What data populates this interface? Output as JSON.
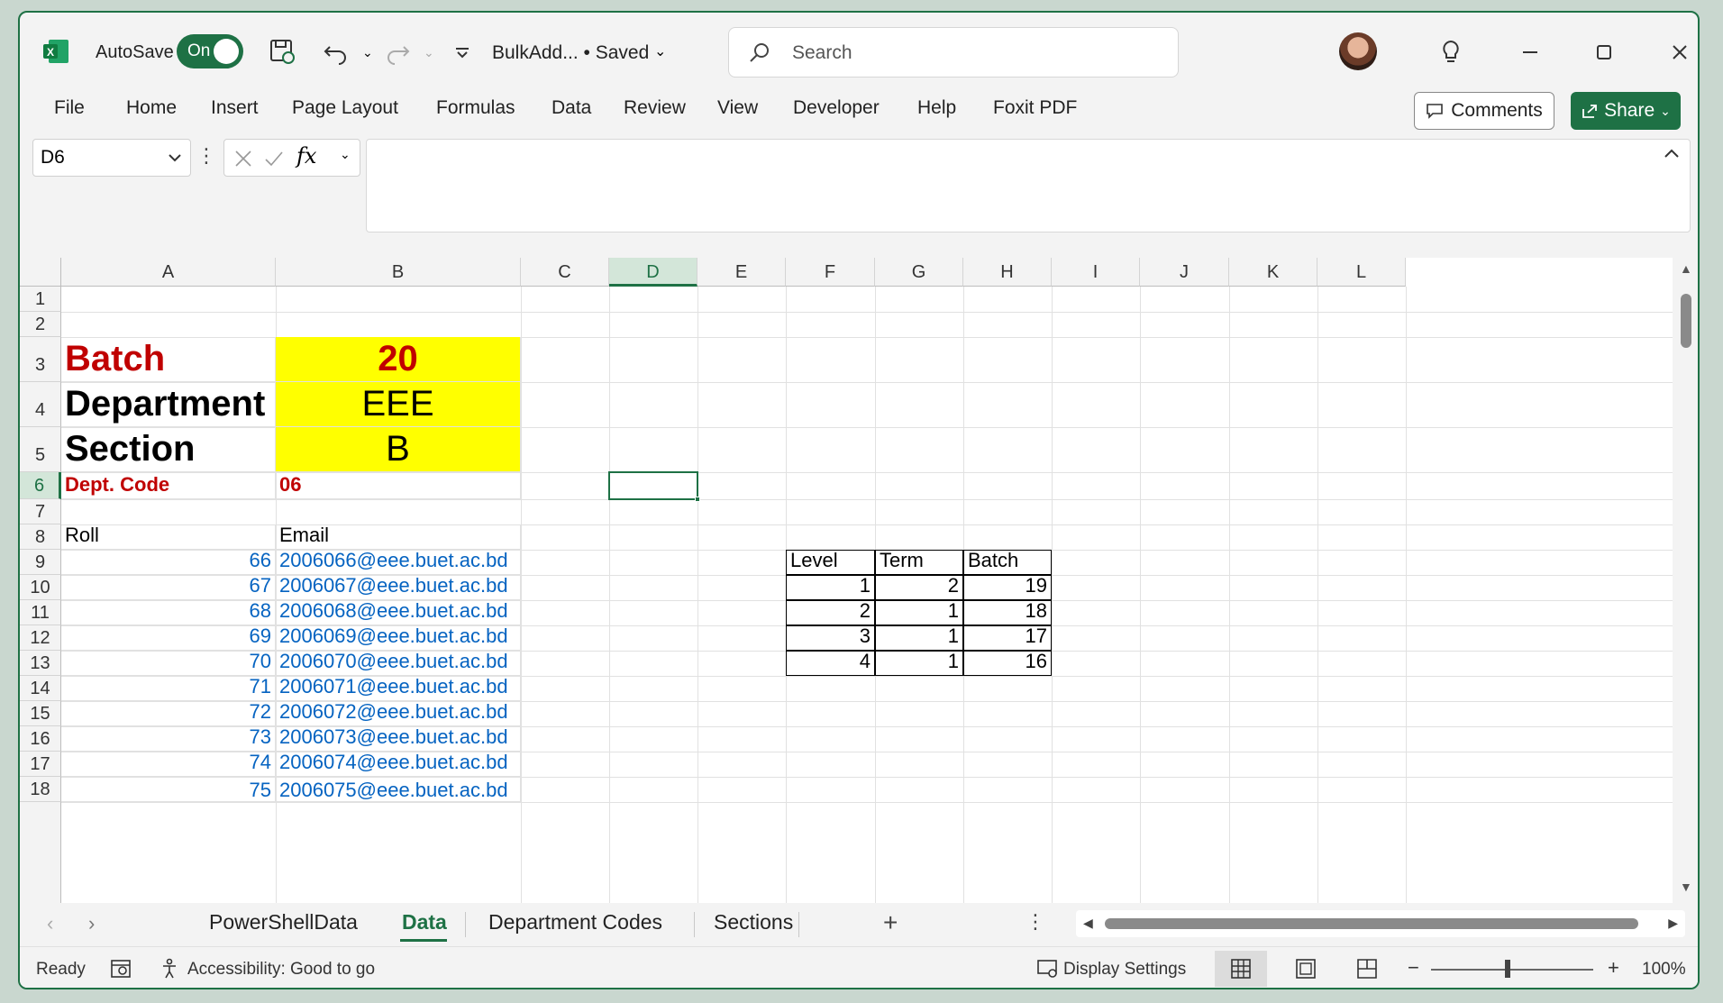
{
  "titlebar": {
    "autosave_label": "AutoSave",
    "autosave_state": "On",
    "doc_title": "BulkAdd...  •  Saved",
    "search_placeholder": "Search"
  },
  "menu": [
    "File",
    "Home",
    "Insert",
    "Page Layout",
    "Formulas",
    "Data",
    "Review",
    "View",
    "Developer",
    "Help",
    "Foxit PDF"
  ],
  "comments_label": "Comments",
  "share_label": "Share",
  "namebox": "D6",
  "columns": [
    "A",
    "B",
    "C",
    "D",
    "E",
    "F",
    "G",
    "H",
    "I",
    "J",
    "K",
    "L"
  ],
  "rows": [
    "1",
    "2",
    "3",
    "4",
    "5",
    "6",
    "7",
    "8",
    "9",
    "10",
    "11",
    "12",
    "13",
    "14",
    "15",
    "16",
    "17",
    "18"
  ],
  "cells": {
    "a3": "Batch",
    "b3": "20",
    "a4": "Department",
    "b4": "EEE",
    "a5": "Section",
    "b5": "B",
    "a6": "Dept. Code",
    "b6": "06",
    "a8": "Roll",
    "b8": "Email"
  },
  "roll_list": [
    {
      "roll": "66",
      "email": "2006066@eee.buet.ac.bd"
    },
    {
      "roll": "67",
      "email": "2006067@eee.buet.ac.bd"
    },
    {
      "roll": "68",
      "email": "2006068@eee.buet.ac.bd"
    },
    {
      "roll": "69",
      "email": "2006069@eee.buet.ac.bd"
    },
    {
      "roll": "70",
      "email": "2006070@eee.buet.ac.bd"
    },
    {
      "roll": "71",
      "email": "2006071@eee.buet.ac.bd"
    },
    {
      "roll": "72",
      "email": "2006072@eee.buet.ac.bd"
    },
    {
      "roll": "73",
      "email": "2006073@eee.buet.ac.bd"
    },
    {
      "roll": "74",
      "email": "2006074@eee.buet.ac.bd"
    },
    {
      "roll": "75",
      "email": "2006075@eee.buet.ac.bd"
    }
  ],
  "level_table": {
    "headers": [
      "Level",
      "Term",
      "Batch"
    ],
    "rows": [
      [
        "1",
        "2",
        "19"
      ],
      [
        "2",
        "1",
        "18"
      ],
      [
        "3",
        "1",
        "17"
      ],
      [
        "4",
        "1",
        "16"
      ]
    ]
  },
  "sheet_tabs": [
    "PowerShellData",
    "Data",
    "Department Codes",
    "Sections"
  ],
  "active_tab": "Data",
  "status": {
    "ready": "Ready",
    "accessibility": "Accessibility: Good to go",
    "display_settings": "Display Settings",
    "zoom": "100%"
  },
  "colors": {
    "accent": "#1e7145",
    "highlight": "#ffff00",
    "red_text": "#c00000",
    "link_blue": "#0563c1"
  }
}
